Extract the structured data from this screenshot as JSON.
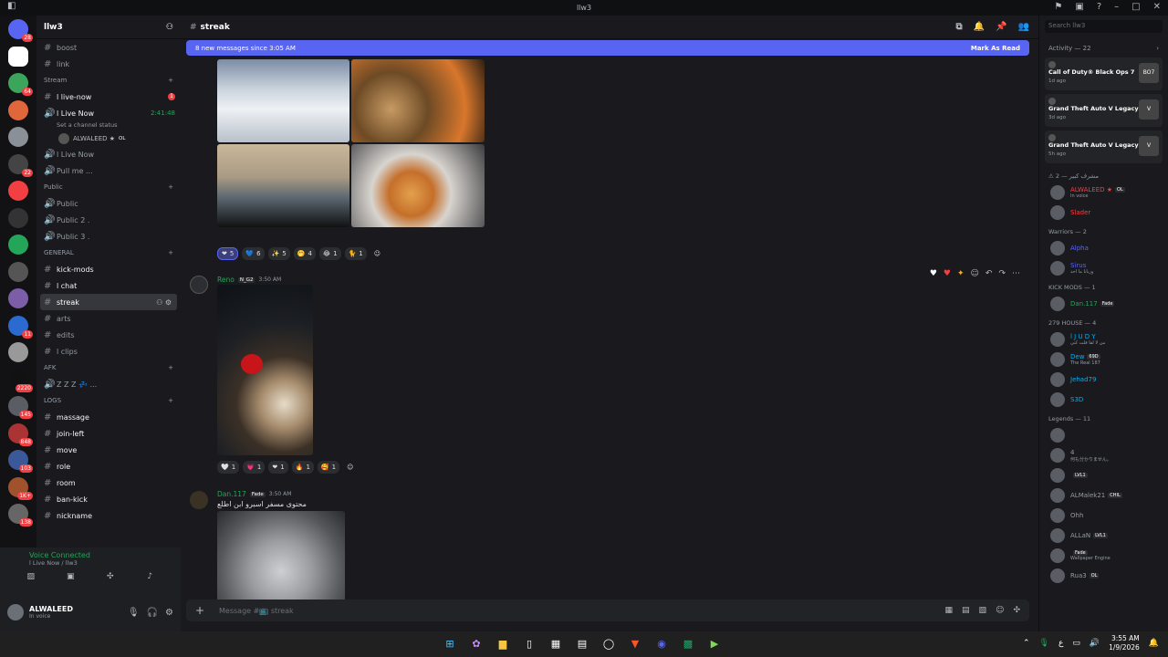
{
  "window": {
    "title": "llw3"
  },
  "server": {
    "name": "llw3"
  },
  "rail": {
    "badges": [
      "28",
      "",
      "64",
      "",
      "",
      "22",
      "",
      "",
      "",
      "",
      "",
      "11",
      "",
      "2220",
      "145",
      "848",
      "103",
      "1K+",
      "138"
    ]
  },
  "channels": {
    "top_items": [
      "boost",
      "link"
    ],
    "stream_category": "Stream",
    "stream_items": [
      {
        "label": "l live-now",
        "type": "text",
        "badge": "1"
      },
      {
        "label": "l Live Now",
        "type": "voice",
        "timer": "2:41:48",
        "status": "Set a channel status"
      },
      {
        "label": "l Live Now",
        "type": "voice"
      },
      {
        "label": "Pull me ...",
        "type": "voice"
      }
    ],
    "voice_user": "ALWALEED ★",
    "voice_user_tag": "OL",
    "public_category": "Public",
    "public_items": [
      "Public",
      "Public 2 .",
      "Public 3 ."
    ],
    "general_category": "GENERAL",
    "general_items": [
      {
        "label": "kick-mods",
        "bold": true
      },
      {
        "label": "l chat",
        "bold": true
      },
      {
        "label": "streak",
        "selected": true
      },
      {
        "label": "arts"
      },
      {
        "label": "edits"
      },
      {
        "label": "l clips"
      }
    ],
    "afk_category": "AFK",
    "afk_items": [
      "Z Z Z 💤 ..."
    ],
    "logs_category": "LOGS",
    "logs_items": [
      "massage",
      "join-left",
      "move",
      "role",
      "room",
      "ban-kick",
      "nickname"
    ]
  },
  "voice_panel": {
    "status": "Voice Connected",
    "location": "l Live Now / llw3"
  },
  "user_panel": {
    "name": "ALWALEED",
    "status": "In voice"
  },
  "header": {
    "channel": "streak"
  },
  "new_messages": {
    "text": "8 new messages since 3:05 AM",
    "action": "Mark As Read"
  },
  "feed": {
    "reactions1": [
      {
        "emoji": "❤",
        "count": "5",
        "me": true
      },
      {
        "emoji": "💙",
        "count": "6",
        "me": false
      },
      {
        "emoji": "✨",
        "count": "5",
        "me": false
      },
      {
        "emoji": "🤭",
        "count": "4",
        "me": false
      },
      {
        "emoji": "😂",
        "count": "1",
        "me": false
      },
      {
        "emoji": "🐈",
        "count": "1",
        "me": false
      }
    ],
    "msg2": {
      "author": "Reno",
      "tag": "N_G2",
      "time": "3:50 AM"
    },
    "reactions2": [
      {
        "emoji": "🤍",
        "count": "1"
      },
      {
        "emoji": "💗",
        "count": "1"
      },
      {
        "emoji": "❤",
        "count": "1"
      },
      {
        "emoji": "🔥",
        "count": "1"
      },
      {
        "emoji": "🥰",
        "count": "1"
      }
    ],
    "msg3": {
      "author": "Dan.117",
      "tag": "Fade",
      "time": "3:50 AM",
      "text": "محتوى مسفر اسبرو ابن اطلع"
    }
  },
  "composer": {
    "placeholder": "Message #📺 streak"
  },
  "members": {
    "search": "Search llw3",
    "activity_label": "Activity — 22",
    "activities": [
      {
        "game": "Call of Duty® Black Ops 7",
        "ago": "1d ago",
        "icon": "BO7"
      },
      {
        "game": "Grand Theft Auto V Legacy",
        "ago": "3d ago",
        "icon": "V"
      },
      {
        "game": "Grand Theft Auto V Legacy",
        "ago": "5h ago",
        "icon": "V"
      }
    ],
    "groups": [
      {
        "label": "⚠ مشرف كبير — 2",
        "members": [
          {
            "name": "ALWALEED ★",
            "sub": "In voice",
            "color": "#f23f43",
            "tag": "OL"
          },
          {
            "name": "Slader",
            "sub": "",
            "color": "#f23f43",
            "tag": ""
          }
        ]
      },
      {
        "label": "Warriors — 2",
        "members": [
          {
            "name": "Alpha",
            "sub": "",
            "color": "#5865f2",
            "tag": ""
          },
          {
            "name": "Sirus",
            "sub": "وربانا ما احد",
            "color": "#5865f2",
            "tag": ""
          }
        ]
      },
      {
        "label": "KICK MODS — 1",
        "members": [
          {
            "name": "Dan.117",
            "sub": "",
            "color": "#23a55a",
            "tag": "Fade"
          }
        ]
      },
      {
        "label": "279 HOUSE — 4",
        "members": [
          {
            "name": "l J U D Y",
            "sub": "من لا لقا قلت كني",
            "color": "#00b0f4",
            "tag": ""
          },
          {
            "name": "Dew",
            "sub": "The Real 187",
            "color": "#00b0f4",
            "tag": "69D"
          },
          {
            "name": "Jehad79",
            "sub": "",
            "color": "#00b0f4",
            "tag": ""
          },
          {
            "name": "S3D",
            "sub": "",
            "color": "#00b0f4",
            "tag": ""
          }
        ]
      },
      {
        "label": "Legends — 11",
        "members": [
          {
            "name": "",
            "sub": "",
            "color": "#949ba4",
            "tag": ""
          },
          {
            "name": "4",
            "sub": "何も分かりません。",
            "color": "#949ba4",
            "tag": ""
          },
          {
            "name": "",
            "sub": "",
            "color": "#949ba4",
            "tag": "LVL1"
          },
          {
            "name": "ALMalek21",
            "sub": "",
            "color": "#949ba4",
            "tag": "CHIL"
          },
          {
            "name": "Ohh",
            "sub": "",
            "color": "#949ba4",
            "tag": ""
          },
          {
            "name": "ALLaN",
            "sub": "",
            "color": "#949ba4",
            "tag": "LVL1"
          },
          {
            "name": "",
            "sub": "Wallpaper Engine",
            "color": "#949ba4",
            "tag": "Fade"
          },
          {
            "name": "Rua3",
            "sub": "",
            "color": "#949ba4",
            "tag": "OL"
          }
        ]
      }
    ]
  },
  "taskbar": {
    "time": "3:55 AM",
    "date": "1/9/2026",
    "lang": "ع"
  }
}
